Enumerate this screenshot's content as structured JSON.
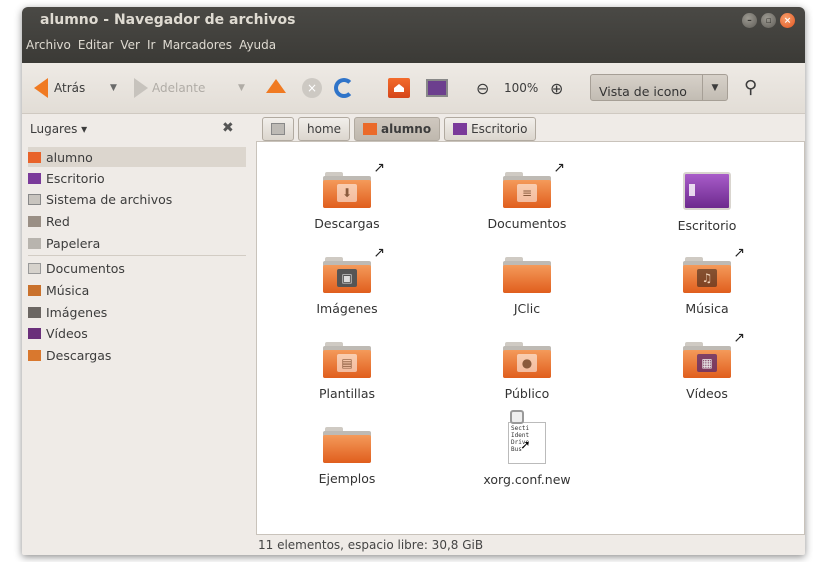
{
  "window": {
    "title": "alumno - Navegador de archivos"
  },
  "menu": [
    "Archivo",
    "Editar",
    "Ver",
    "Ir",
    "Marcadores",
    "Ayuda"
  ],
  "toolbar": {
    "back_label": "Atrás",
    "forward_label": "Adelante",
    "zoom_label": "100%",
    "view_mode": "Vista de icono"
  },
  "places": {
    "header": "Lugares ▾",
    "items": [
      "alumno",
      "Escritorio",
      "Sistema de archivos",
      "Red",
      "Papelera",
      "Documentos",
      "Música",
      "Imágenes",
      "Vídeos",
      "Descargas"
    ]
  },
  "breadcrumbs": [
    "home",
    "alumno",
    "Escritorio"
  ],
  "files": [
    "Descargas",
    "Documentos",
    "Escritorio",
    "Imágenes",
    "JClic",
    "Música",
    "Plantillas",
    "Público",
    "Vídeos",
    "Ejemplos",
    "xorg.conf.new"
  ],
  "doc_preview": [
    "Secti",
    "Ident",
    "Drive",
    "Bus"
  ],
  "status": "11 elementos, espacio libre: 30,8 GiB",
  "colors": {
    "accent": "#e8632a",
    "titlebar": "#3b3a36"
  }
}
